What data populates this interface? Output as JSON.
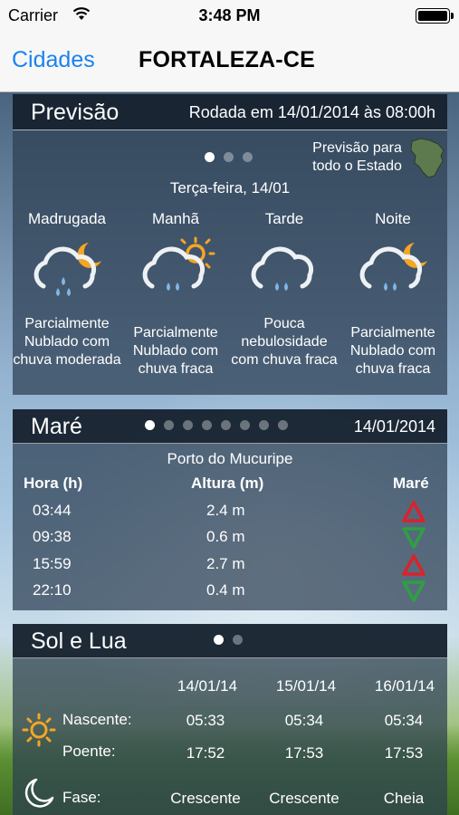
{
  "status_bar": {
    "carrier": "Carrier",
    "time": "3:48 PM"
  },
  "nav": {
    "back_label": "Cidades",
    "title": "FORTALEZA-CE"
  },
  "previsao": {
    "title": "Previsão",
    "rodada": "Rodada em 14/01/2014 às 08:00h",
    "state_link": "Previsão para todo o Estado",
    "date": "Terça-feira, 14/01",
    "pages": 3,
    "active_page": 1,
    "periods": [
      {
        "name": "Madrugada",
        "icon": "cloud-rain-moon-icon",
        "desc": "Parcialmente Nublado com chuva moderada"
      },
      {
        "name": "Manhã",
        "icon": "cloud-rain-sun-icon",
        "desc": "Parcialmente Nublado com chuva fraca"
      },
      {
        "name": "Tarde",
        "icon": "cloud-rain-icon",
        "desc": "Pouca nebulosidade com chuva fraca"
      },
      {
        "name": "Noite",
        "icon": "cloud-rain-moon-icon",
        "desc": "Parcialmente Nublado com chuva fraca"
      }
    ]
  },
  "mare": {
    "title": "Maré",
    "date": "14/01/2014",
    "pages": 8,
    "active_page": 1,
    "port": "Porto do Mucuripe",
    "headers": {
      "hora": "Hora (h)",
      "altura": "Altura (m)",
      "mare": "Maré"
    },
    "rows": [
      {
        "hora": "03:44",
        "altura": "2.4 m",
        "trend": "high"
      },
      {
        "hora": "09:38",
        "altura": "0.6 m",
        "trend": "low"
      },
      {
        "hora": "15:59",
        "altura": "2.7 m",
        "trend": "high"
      },
      {
        "hora": "22:10",
        "altura": "0.4 m",
        "trend": "low"
      }
    ]
  },
  "sol_lua": {
    "title": "Sol e Lua",
    "pages": 2,
    "active_page": 1,
    "dates": [
      "14/01/14",
      "15/01/14",
      "16/01/14"
    ],
    "nascente_label": "Nascente:",
    "poente_label": "Poente:",
    "fase_label": "Fase:",
    "nascente": [
      "05:33",
      "05:34",
      "05:34"
    ],
    "poente": [
      "17:52",
      "17:53",
      "17:53"
    ],
    "fase": [
      "Crescente",
      "Crescente",
      "Cheia"
    ]
  },
  "colors": {
    "link": "#1a82f0",
    "tide_high": "#d9232b",
    "tide_low": "#2ea043",
    "sun": "#f5a623",
    "rain": "#7fb6e8"
  }
}
